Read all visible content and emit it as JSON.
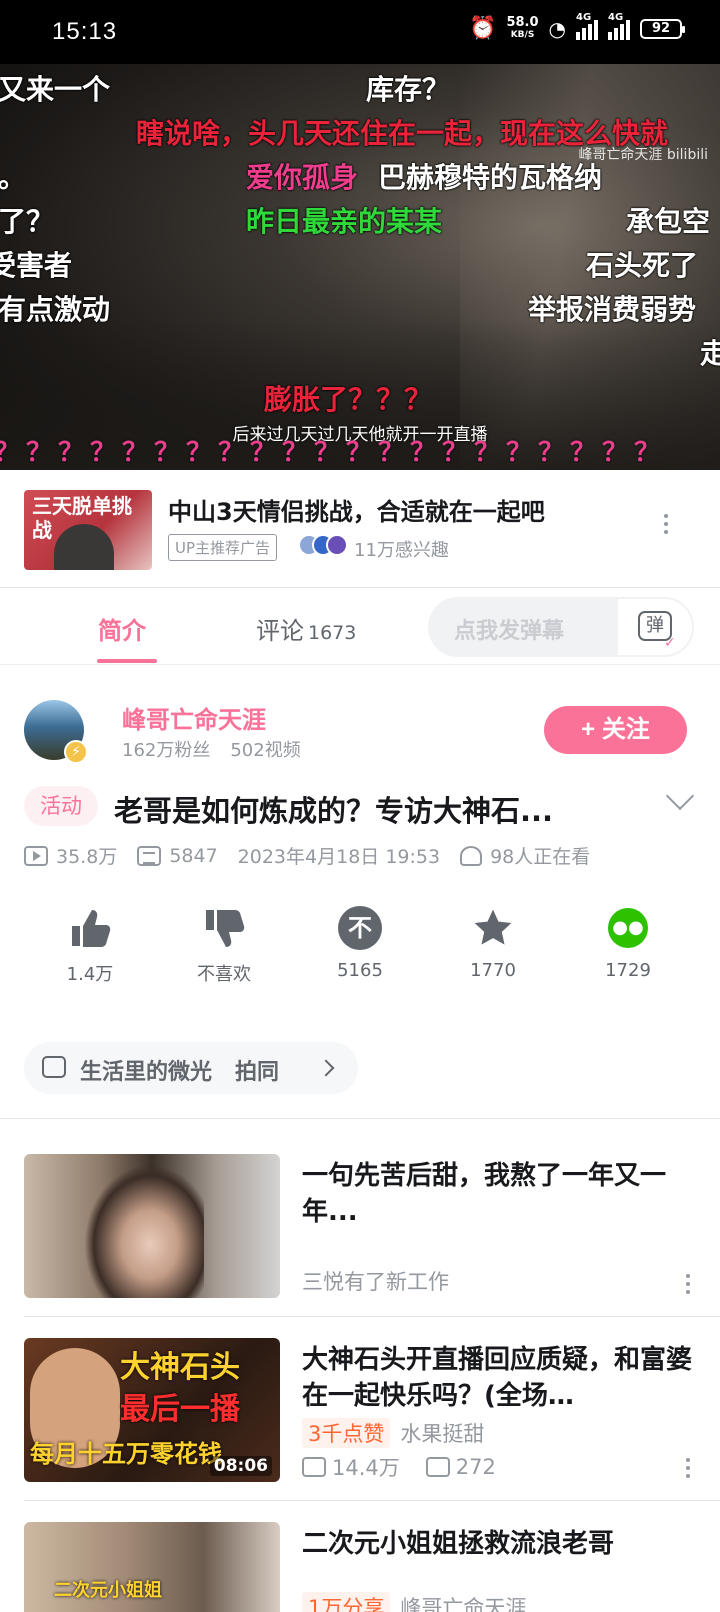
{
  "status_bar": {
    "time": "15:13",
    "net_speed": "58.0",
    "net_unit": "KB/S",
    "signal1": "4G",
    "signal2": "4G",
    "battery": "92"
  },
  "player": {
    "watermark": "峰哥亡命天涯 bilibili",
    "subtitle": "后来过几天过几天他就开一开直播",
    "danmaku": [
      {
        "text": "又来一个",
        "color": "white"
      },
      {
        "text": "库存？",
        "color": "white"
      },
      {
        "text": "瞎说啥，头几天还住在一起，现在这么快就",
        "color": "red"
      },
      {
        "text": "。",
        "color": "white"
      },
      {
        "text": "爱你孤身",
        "color": "pink"
      },
      {
        "text": "巴赫穆特的瓦格纳",
        "color": "white"
      },
      {
        "text": "了？",
        "color": "white"
      },
      {
        "text": "昨日最亲的某某",
        "color": "green"
      },
      {
        "text": "承包空",
        "color": "white"
      },
      {
        "text": "受害者",
        "color": "white"
      },
      {
        "text": "石头死了",
        "color": "white"
      },
      {
        "text": "有点激动",
        "color": "white"
      },
      {
        "text": "举报消费弱势",
        "color": "white"
      },
      {
        "text": "走",
        "color": "white"
      },
      {
        "text": "膨胀了？？？",
        "color": "red"
      },
      {
        "text": "？？？？？？？？？？？？？？？？？？？？？",
        "color": "pink"
      }
    ]
  },
  "ad": {
    "thumb_text": "三天脱单挑战",
    "title": "中山3天情侣挑战，合适就在一起吧",
    "tag": "UP主推荐广告",
    "interest": "11万感兴趣"
  },
  "tabs": {
    "intro": "简介",
    "comments": "评论",
    "comments_count": "1673",
    "danmu_placeholder": "点我发弹幕",
    "danmu_switch": "弹"
  },
  "uploader": {
    "name": "峰哥亡命天涯",
    "fans": "162万粉丝",
    "videos": "502视频",
    "follow": "+ 关注"
  },
  "video": {
    "tag": "活动",
    "title": "老哥是如何炼成的？专访大神石...",
    "plays": "35.8万",
    "danmaku_count": "5847",
    "date": "2023年4月18日 19:53",
    "watching": "98人正在看"
  },
  "actions": [
    {
      "icon": "thumbs-up-icon",
      "label": "1.4万"
    },
    {
      "icon": "thumbs-down-icon",
      "label": "不喜欢"
    },
    {
      "icon": "coin-icon",
      "label": "5165"
    },
    {
      "icon": "star-icon",
      "label": "1770"
    },
    {
      "icon": "wechat-icon",
      "label": "1729"
    }
  ],
  "topic": {
    "text": "生活里的微光",
    "extra": "拍同"
  },
  "related": [
    {
      "title": "一句先苦后甜，我熬了一年又一年...",
      "author": "三悦有了新工作"
    },
    {
      "title": "大神石头开直播回应质疑，和富婆在一起快乐吗？(全场…",
      "badge": "3千点赞",
      "author": "水果挺甜",
      "plays": "14.4万",
      "danmaku": "272",
      "duration": "08:06",
      "thumb_text1": "大神石头",
      "thumb_text2": "最后一播",
      "thumb_text3": "每月十五万零花钱"
    },
    {
      "title": "二次元小姐姐拯救流浪老哥",
      "badge": "1万分享",
      "author": "峰哥亡命天涯",
      "thumb_text": "二次元小姐姐"
    }
  ],
  "colors": {
    "accent": "#fb7299",
    "text": "#18191c",
    "muted": "#9499a0"
  }
}
